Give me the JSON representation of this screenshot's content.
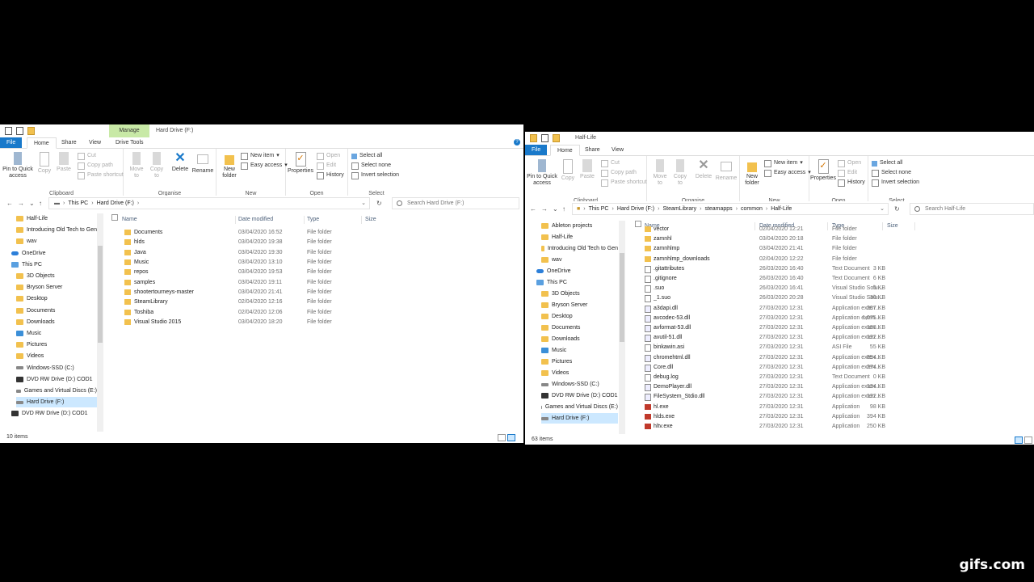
{
  "w1": {
    "context_tab": "Manage",
    "title": "Hard Drive (F:)",
    "tabs": [
      "File",
      "Home",
      "Share",
      "View",
      "Drive Tools"
    ],
    "ribbon": {
      "clipboard": {
        "pin": "Pin to Quick access",
        "copy": "Copy",
        "paste": "Paste",
        "cut": "Cut",
        "copy_path": "Copy path",
        "paste_shortcut": "Paste shortcut",
        "label": "Clipboard"
      },
      "organise": {
        "move": "Move to",
        "copy_to": "Copy to",
        "delete": "Delete",
        "rename": "Rename",
        "label": "Organise"
      },
      "new": {
        "new_folder": "New folder",
        "new_item": "New item",
        "easy_access": "Easy access",
        "label": "New"
      },
      "open": {
        "properties": "Properties",
        "open": "Open",
        "edit": "Edit",
        "history": "History",
        "label": "Open"
      },
      "select": {
        "select_all": "Select all",
        "select_none": "Select none",
        "invert": "Invert selection",
        "label": "Select"
      }
    },
    "crumbs": [
      "This PC",
      "Hard Drive (F:)"
    ],
    "search_placeholder": "Search Hard Drive (F:)",
    "nav": [
      {
        "label": "Half-Life",
        "icon": "folder-icon"
      },
      {
        "label": "Introducing Old Tech to Gen",
        "icon": "folder-icon"
      },
      {
        "label": "wav",
        "icon": "folder-icon"
      },
      {
        "label": "OneDrive",
        "icon": "cloud-icon"
      },
      {
        "label": "This PC",
        "icon": "pc-icon"
      },
      {
        "label": "3D Objects",
        "icon": "folder-icon"
      },
      {
        "label": "Bryson Server",
        "icon": "folder-icon"
      },
      {
        "label": "Desktop",
        "icon": "folder-icon"
      },
      {
        "label": "Documents",
        "icon": "folder-icon"
      },
      {
        "label": "Downloads",
        "icon": "folder-icon"
      },
      {
        "label": "Music",
        "icon": "music-icon"
      },
      {
        "label": "Pictures",
        "icon": "folder-icon"
      },
      {
        "label": "Videos",
        "icon": "folder-icon"
      },
      {
        "label": "Windows-SSD (C:)",
        "icon": "drive-icon"
      },
      {
        "label": "DVD RW Drive (D:) COD1",
        "icon": "dvd-icon"
      },
      {
        "label": "Games and Virtual Discs (E:)",
        "icon": "drive-icon"
      },
      {
        "label": "Hard Drive (F:)",
        "icon": "drive-icon",
        "selected": true
      },
      {
        "label": "DVD RW Drive (D:) COD1",
        "icon": "dvd-icon"
      }
    ],
    "columns": [
      "Name",
      "Date modified",
      "Type",
      "Size"
    ],
    "files": [
      {
        "name": "Documents",
        "date": "03/04/2020 16:52",
        "type": "File folder",
        "size": ""
      },
      {
        "name": "hlds",
        "date": "03/04/2020 19:38",
        "type": "File folder",
        "size": ""
      },
      {
        "name": "Java",
        "date": "03/04/2020 19:30",
        "type": "File folder",
        "size": ""
      },
      {
        "name": "Music",
        "date": "03/04/2020 13:10",
        "type": "File folder",
        "size": ""
      },
      {
        "name": "repos",
        "date": "03/04/2020 19:53",
        "type": "File folder",
        "size": ""
      },
      {
        "name": "samples",
        "date": "03/04/2020 19:11",
        "type": "File folder",
        "size": ""
      },
      {
        "name": "shootertourneys-master",
        "date": "03/04/2020 21:41",
        "type": "File folder",
        "size": ""
      },
      {
        "name": "SteamLibrary",
        "date": "02/04/2020 12:16",
        "type": "File folder",
        "size": ""
      },
      {
        "name": "Toshiba",
        "date": "02/04/2020 12:06",
        "type": "File folder",
        "size": ""
      },
      {
        "name": "Visual Studio 2015",
        "date": "03/04/2020 18:20",
        "type": "File folder",
        "size": ""
      }
    ],
    "status": "10 items"
  },
  "w2": {
    "title": "Half-Life",
    "tabs": [
      "File",
      "Home",
      "Share",
      "View"
    ],
    "ribbon": {
      "clipboard": {
        "pin": "Pin to Quick access",
        "copy": "Copy",
        "paste": "Paste",
        "cut": "Cut",
        "copy_path": "Copy path",
        "paste_shortcut": "Paste shortcut",
        "label": "Clipboard"
      },
      "organise": {
        "move": "Move to",
        "copy_to": "Copy to",
        "delete": "Delete",
        "rename": "Rename",
        "label": "Organise"
      },
      "new": {
        "new_folder": "New folder",
        "new_item": "New item",
        "easy_access": "Easy access",
        "label": "New"
      },
      "open": {
        "properties": "Properties",
        "open": "Open",
        "edit": "Edit",
        "history": "History",
        "label": "Open"
      },
      "select": {
        "select_all": "Select all",
        "select_none": "Select none",
        "invert": "Invert selection",
        "label": "Select"
      }
    },
    "crumbs": [
      "This PC",
      "Hard Drive (F:)",
      "SteamLibrary",
      "steamapps",
      "common",
      "Half-Life"
    ],
    "search_placeholder": "Search Half-Life",
    "nav": [
      {
        "label": "Ableton projects",
        "icon": "folder-icon"
      },
      {
        "label": "Half-Life",
        "icon": "folder-icon"
      },
      {
        "label": "Introducing Old Tech to Gen",
        "icon": "folder-icon"
      },
      {
        "label": "wav",
        "icon": "folder-icon"
      },
      {
        "label": "OneDrive",
        "icon": "cloud-icon"
      },
      {
        "label": "This PC",
        "icon": "pc-icon"
      },
      {
        "label": "3D Objects",
        "icon": "folder-icon"
      },
      {
        "label": "Bryson Server",
        "icon": "folder-icon"
      },
      {
        "label": "Desktop",
        "icon": "folder-icon"
      },
      {
        "label": "Documents",
        "icon": "folder-icon"
      },
      {
        "label": "Downloads",
        "icon": "folder-icon"
      },
      {
        "label": "Music",
        "icon": "music-icon"
      },
      {
        "label": "Pictures",
        "icon": "folder-icon"
      },
      {
        "label": "Videos",
        "icon": "folder-icon"
      },
      {
        "label": "Windows-SSD (C:)",
        "icon": "drive-icon"
      },
      {
        "label": "DVD RW Drive (D:) COD1",
        "icon": "dvd-icon"
      },
      {
        "label": "Games and Virtual Discs (E:)",
        "icon": "drive-icon"
      },
      {
        "label": "Hard Drive (F:)",
        "icon": "drive-icon",
        "selected": true
      }
    ],
    "columns": [
      "Name",
      "Date modified",
      "Type",
      "Size"
    ],
    "files": [
      {
        "name": "vector",
        "date": "02/04/2020 12:21",
        "type": "File folder",
        "size": "",
        "icon": "folder-icon"
      },
      {
        "name": "zamnhl",
        "date": "03/04/2020 20:18",
        "type": "File folder",
        "size": "",
        "icon": "folder-icon"
      },
      {
        "name": "zamnhlmp",
        "date": "03/04/2020 21:41",
        "type": "File folder",
        "size": "",
        "icon": "folder-icon"
      },
      {
        "name": "zamnhlmp_downloads",
        "date": "02/04/2020 12:22",
        "type": "File folder",
        "size": "",
        "icon": "folder-icon"
      },
      {
        "name": ".gitattributes",
        "date": "26/03/2020 16:40",
        "type": "Text Document",
        "size": "3 KB",
        "icon": "file-icon"
      },
      {
        "name": ".gitignore",
        "date": "26/03/2020 16:40",
        "type": "Text Document",
        "size": "6 KB",
        "icon": "file-icon"
      },
      {
        "name": ".suo",
        "date": "26/03/2020 16:41",
        "type": "Visual Studio Solu...",
        "size": "5 KB",
        "icon": "file-icon"
      },
      {
        "name": "_1.suo",
        "date": "26/03/2020 20:28",
        "type": "Visual Studio Solu...",
        "size": "30 KB",
        "icon": "file-icon"
      },
      {
        "name": "a3dapi.dll",
        "date": "27/03/2020 12:31",
        "type": "Application exten...",
        "size": "207 KB",
        "icon": "dll-icon"
      },
      {
        "name": "avcodec-53.dll",
        "date": "27/03/2020 12:31",
        "type": "Application exten...",
        "size": "1,075 KB",
        "icon": "dll-icon"
      },
      {
        "name": "avformat-53.dll",
        "date": "27/03/2020 12:31",
        "type": "Application exten...",
        "size": "188 KB",
        "icon": "dll-icon"
      },
      {
        "name": "avutil-51.dll",
        "date": "27/03/2020 12:31",
        "type": "Application exten...",
        "size": "122 KB",
        "icon": "dll-icon"
      },
      {
        "name": "binkawin.asi",
        "date": "27/03/2020 12:31",
        "type": "ASI File",
        "size": "55 KB",
        "icon": "file-icon"
      },
      {
        "name": "chromehtml.dll",
        "date": "27/03/2020 12:31",
        "type": "Application exten...",
        "size": "854 KB",
        "icon": "dll-icon"
      },
      {
        "name": "Core.dll",
        "date": "27/03/2020 12:31",
        "type": "Application exten...",
        "size": "274 KB",
        "icon": "dll-icon"
      },
      {
        "name": "debug.log",
        "date": "27/03/2020 12:31",
        "type": "Text Document",
        "size": "0 KB",
        "icon": "file-icon"
      },
      {
        "name": "DemoPlayer.dll",
        "date": "27/03/2020 12:31",
        "type": "Application exten...",
        "size": "134 KB",
        "icon": "dll-icon"
      },
      {
        "name": "FileSystem_Stdio.dll",
        "date": "27/03/2020 12:31",
        "type": "Application exten...",
        "size": "122 KB",
        "icon": "dll-icon"
      },
      {
        "name": "hl.exe",
        "date": "27/03/2020 12:31",
        "type": "Application",
        "size": "98 KB",
        "icon": "exe-icon"
      },
      {
        "name": "hlds.exe",
        "date": "27/03/2020 12:31",
        "type": "Application",
        "size": "394 KB",
        "icon": "exe-icon"
      },
      {
        "name": "hltv.exe",
        "date": "27/03/2020 12:31",
        "type": "Application",
        "size": "250 KB",
        "icon": "exe-icon"
      }
    ],
    "status": "63 items"
  },
  "watermark": "gifs.com",
  "colors": {
    "file_tab": "#1979ca",
    "manage_tab": "#c8e9a6",
    "selection": "#cce8ff",
    "folder": "#f2c14e"
  }
}
